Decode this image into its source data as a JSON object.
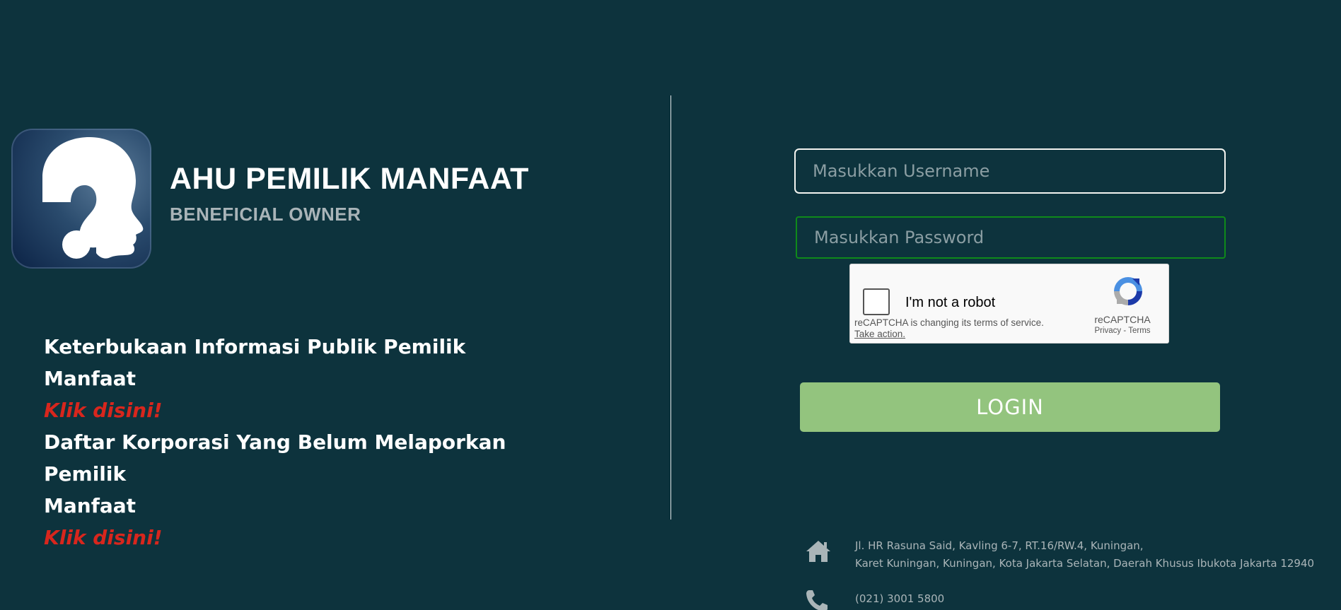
{
  "brand": {
    "title": "AHU PEMILIK MANFAAT",
    "subtitle": "BENEFICIAL OWNER",
    "logo_icon": "question-head-icon"
  },
  "info": {
    "heading1": "Keterbukaan Informasi Publik Pemilik Manfaat",
    "link1": "Klik disini!",
    "heading2_line1": "Daftar Korporasi Yang Belum Melaporkan Pemilik",
    "heading2_line2": "Manfaat",
    "link2": "Klik disini!"
  },
  "login_form": {
    "username_placeholder": "Masukkan Username",
    "username_value": "",
    "password_placeholder": "Masukkan Password",
    "password_value": "",
    "submit_label": "LOGIN"
  },
  "recaptcha": {
    "label": "I'm not a robot",
    "notice": "reCAPTCHA is changing its terms of service.",
    "action": "Take action.",
    "brand": "reCAPTCHA",
    "privacy": "Privacy",
    "separator": "-",
    "terms": "Terms"
  },
  "contact": {
    "address_line1": "Jl. HR Rasuna Said, Kavling 6-7, RT.16/RW.4, Kuningan,",
    "address_line2": "Karet Kuningan, Kuningan, Kota Jakarta Selatan, Daerah Khusus Ibukota Jakarta 12940",
    "phone": "(021) 3001 5800",
    "address_icon": "home-icon",
    "phone_icon": "phone-icon"
  },
  "colors": {
    "background": "#0d333d",
    "link_red": "#d8261d",
    "login_green": "#93c47e",
    "password_border": "#0f8a1a"
  }
}
